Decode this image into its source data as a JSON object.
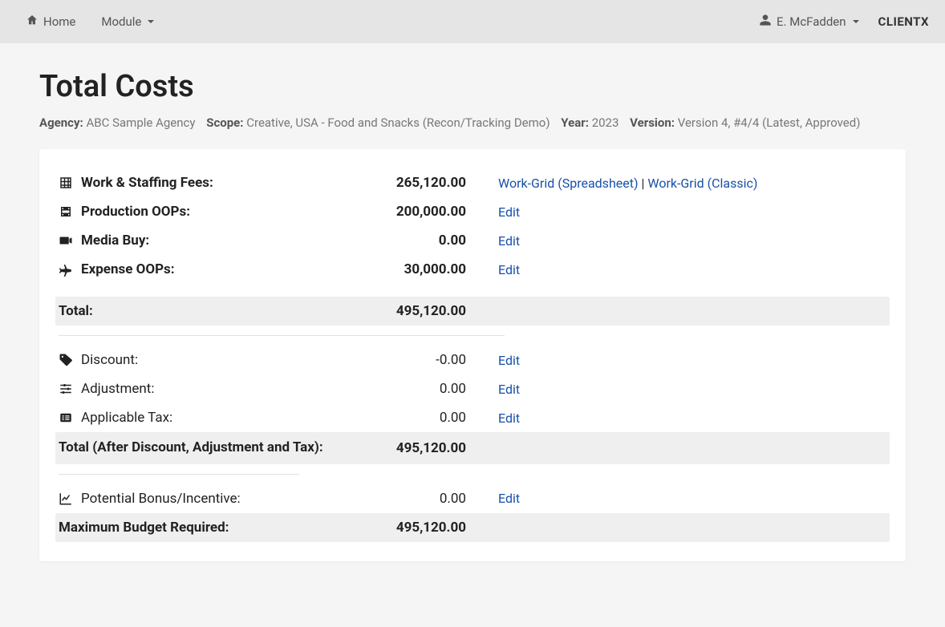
{
  "nav": {
    "home": "Home",
    "module": "Module",
    "user": "E. McFadden",
    "brand": "CLIENTX"
  },
  "page": {
    "title": "Total Costs"
  },
  "meta": {
    "agency_label": "Agency:",
    "agency_value": "ABC Sample Agency",
    "scope_label": "Scope:",
    "scope_value": "Creative, USA - Food and Snacks (Recon/Tracking Demo)",
    "year_label": "Year:",
    "year_value": "2023",
    "version_label": "Version:",
    "version_value": "Version 4, #4/4 (Latest, Approved)"
  },
  "rows": {
    "work_staffing": {
      "label": "Work & Staffing Fees:",
      "value": "265,120.00",
      "link_spreadsheet": "Work-Grid (Spreadsheet)",
      "link_classic": "Work-Grid (Classic)"
    },
    "production_oops": {
      "label": "Production OOPs:",
      "value": "200,000.00",
      "edit": "Edit"
    },
    "media_buy": {
      "label": "Media Buy:",
      "value": "0.00",
      "edit": "Edit"
    },
    "expense_oops": {
      "label": "Expense OOPs:",
      "value": "30,000.00",
      "edit": "Edit"
    },
    "total": {
      "label": "Total:",
      "value": "495,120.00"
    },
    "discount": {
      "label": "Discount:",
      "value": "-0.00",
      "edit": "Edit"
    },
    "adjustment": {
      "label": "Adjustment:",
      "value": "0.00",
      "edit": "Edit"
    },
    "applicable_tax": {
      "label": "Applicable Tax:",
      "value": "0.00",
      "edit": "Edit"
    },
    "total_after": {
      "label": "Total (After Discount, Adjustment and Tax):",
      "value": "495,120.00"
    },
    "potential_bonus": {
      "label": "Potential Bonus/Incentive:",
      "value": "0.00",
      "edit": "Edit"
    },
    "max_budget": {
      "label": "Maximum Budget Required:",
      "value": "495,120.00"
    }
  },
  "sep": " | "
}
